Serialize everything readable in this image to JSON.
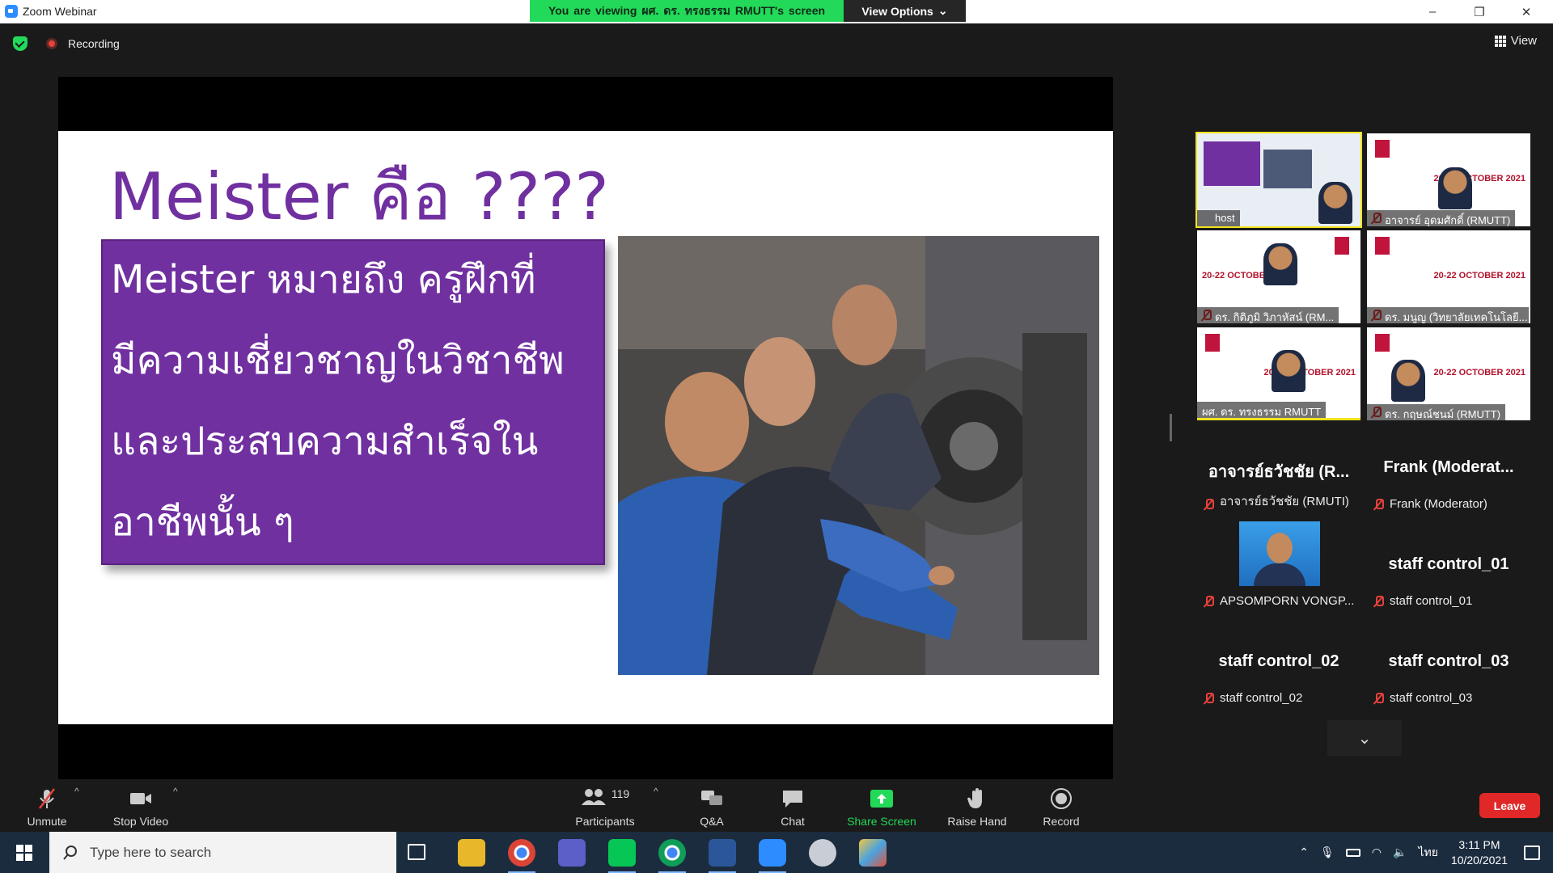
{
  "window": {
    "title": "Zoom Webinar",
    "minimize": "–",
    "maximize": "❐",
    "close": "✕"
  },
  "banner": {
    "viewing": "You are viewing ผศ. ดร. ทรงธรรม RMUTT's screen",
    "view_options": "View Options",
    "view_options_caret": "⌄"
  },
  "status": {
    "recording": "Recording",
    "view": "View"
  },
  "slide": {
    "title": "Meister คือ ????",
    "body": "Meister หมายถึง ครูฝึกที่\nมีความเชี่ยวชาญในวิชาชีพ\nและประสบความสำเร็จใน\nอาชีพนั้น ๆ"
  },
  "video_tiles": [
    {
      "name": "host"
    },
    {
      "name": "อาจารย์ อุดมศักดิ์ (RMUTT)"
    },
    {
      "name": "ดร. กิติภูมิ วิภาหัสน์ (RM..."
    },
    {
      "name": "ดร. มนูญ (วิทยาลัยเทคโนโลยี..."
    },
    {
      "name": "ผศ. ดร. ทรงธรรม RMUTT"
    },
    {
      "name": "ดร. กฤษณ์ชนม์ (RMUTT)"
    }
  ],
  "thumb_text": "20-22 OCTOBER 2021",
  "name_tiles": [
    {
      "big": "อาจารย์ธวัชชัย (R...",
      "small": "อาจารย์ธวัชชัย (RMUTI)"
    },
    {
      "big": "Frank  (Moderat...",
      "small": "Frank (Moderator)"
    },
    {
      "big": "",
      "small": "APSOMPORN VONGP..."
    },
    {
      "big": "staff control_01",
      "small": "staff control_01"
    },
    {
      "big": "staff control_02",
      "small": "staff control_02"
    },
    {
      "big": "staff control_03",
      "small": "staff control_03"
    }
  ],
  "sidebar_more": "⌄",
  "toolbar": {
    "unmute": "Unmute",
    "stop_video": "Stop Video",
    "participants": "Participants",
    "participant_count": "119",
    "qa": "Q&A",
    "chat": "Chat",
    "share_screen": "Share Screen",
    "raise_hand": "Raise Hand",
    "record": "Record",
    "leave": "Leave",
    "caret": "^"
  },
  "colors": {
    "accent_green": "#23d959",
    "slide_purple": "#7030a0",
    "leave_red": "#e02828",
    "highlight_yellow": "#f0e41c"
  },
  "taskbar": {
    "search_placeholder": "Type here to search",
    "language": "ไทย",
    "time": "3:11 PM",
    "date": "10/20/2021",
    "apps": [
      "task-view-icon",
      "file-explorer-icon",
      "chrome-profile-icon",
      "teams-icon",
      "line-icon",
      "chrome-icon",
      "word-icon",
      "zoom-icon",
      "app-icon",
      "paint-icon"
    ]
  }
}
